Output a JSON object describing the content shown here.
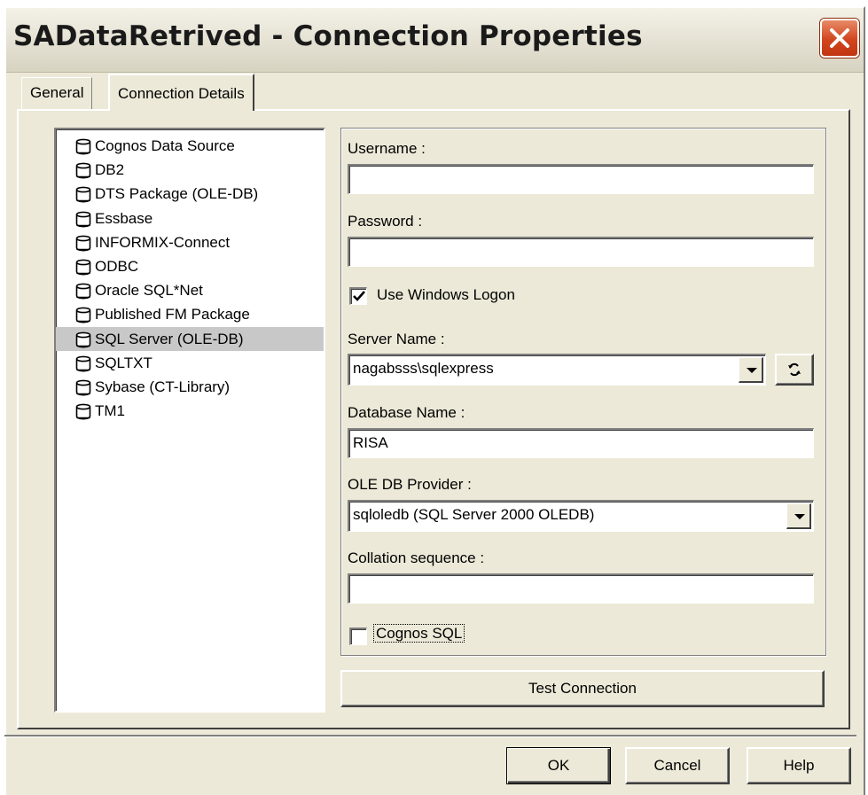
{
  "window": {
    "title": "SADataRetrived - Connection Properties"
  },
  "tabs": [
    {
      "label": "General",
      "active": false
    },
    {
      "label": "Connection Details",
      "active": true
    }
  ],
  "data_sources": {
    "items": [
      "Cognos Data Source",
      "DB2",
      "DTS Package (OLE-DB)",
      "Essbase",
      "INFORMIX-Connect",
      "ODBC",
      "Oracle SQL*Net",
      "Published FM Package",
      "SQL Server (OLE-DB)",
      "SQLTXT",
      "Sybase (CT-Library)",
      "TM1"
    ],
    "selected": "SQL Server (OLE-DB)",
    "icon": "database-icon"
  },
  "form": {
    "username_label": "Username :",
    "username_value": "",
    "password_label": "Password :",
    "password_value": "",
    "use_windows_logon_label": "Use Windows Logon",
    "use_windows_logon_checked": true,
    "server_name_label": "Server Name :",
    "server_name_value": "nagabsss\\sqlexpress",
    "refresh_icon": "refresh-icon",
    "database_name_label": "Database Name :",
    "database_name_value": "RISA",
    "ole_db_provider_label": "OLE DB Provider :",
    "ole_db_provider_value": "sqloledb (SQL Server 2000 OLEDB)",
    "collation_label": "Collation sequence :",
    "collation_value": "",
    "cognos_sql_label": "Cognos SQL",
    "cognos_sql_checked": false,
    "test_connection_label": "Test Connection"
  },
  "footer": {
    "ok_label": "OK",
    "cancel_label": "Cancel",
    "help_label": "Help"
  },
  "colors": {
    "dialog_background": "#ece9d8",
    "close_button": "#d1451e",
    "selection": "#c8c8c8"
  }
}
